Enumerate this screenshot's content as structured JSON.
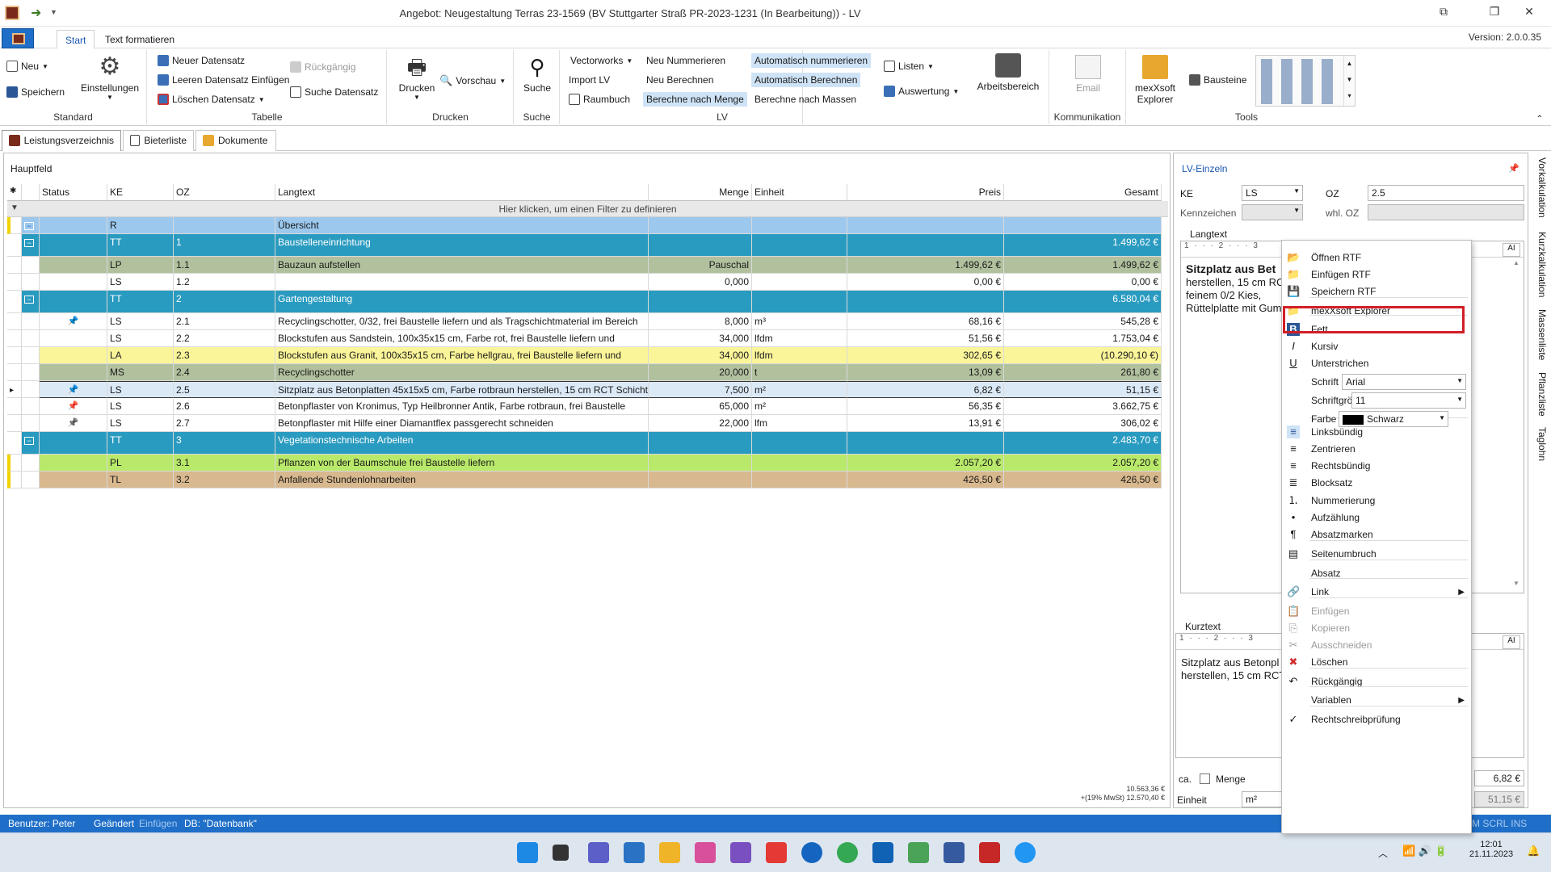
{
  "window": {
    "title": "Angebot: Neugestaltung Terras 23-1569 (BV Stuttgarter Straß PR-2023-1231 (In Bearbeitung)) - LV",
    "version": "Version: 2.0.0.35",
    "tabs": [
      "Start",
      "Text formatieren"
    ]
  },
  "ribbon": {
    "standard": {
      "label": "Standard",
      "neu": "Neu",
      "speichern": "Speichern",
      "einstellungen": "Einstellungen"
    },
    "tabelle": {
      "label": "Tabelle",
      "neuer_datensatz": "Neuer Datensatz",
      "leeren": "Leeren Datensatz Einfügen",
      "loeschen": "Löschen Datensatz",
      "rueckgaengig": "Rückgängig",
      "suche_datensatz": "Suche Datensatz"
    },
    "drucken": {
      "label": "Drucken",
      "drucken": "Drucken",
      "vorschau": "Vorschau"
    },
    "suche": {
      "label": "Suche",
      "suche": "Suche"
    },
    "lv": {
      "label": "LV",
      "vectorworks": "Vectorworks",
      "import_lv": "Import LV",
      "raumbuch": "Raumbuch",
      "neu_nummerieren": "Neu Nummerieren",
      "neu_berechnen": "Neu Berechnen",
      "berechne_menge": "Berechne nach Menge",
      "auto_nummerieren": "Automatisch nummerieren",
      "auto_berechnen": "Automatisch Berechnen",
      "berechne_massen": "Berechne nach Massen"
    },
    "listen": "Listen",
    "auswertung": "Auswertung",
    "arbeitsbereich": "Arbeitsbereich",
    "kommunikation": {
      "label": "Kommunikation",
      "email": "Email"
    },
    "tools": {
      "label": "Tools",
      "explorer": "mexXsoft Explorer",
      "bausteine": "Bausteine"
    }
  },
  "viewtabs": [
    "Leistungsverzeichnis",
    "Bieterliste",
    "Dokumente"
  ],
  "main": {
    "title": "Hauptfeld",
    "columns": [
      "Status",
      "KE",
      "OZ",
      "Langtext",
      "Menge",
      "Einheit",
      "Preis",
      "Gesamt"
    ],
    "filter_hint": "Hier klicken, um einen Filter zu definieren",
    "rows": [
      {
        "ke": "R",
        "oz": "",
        "langtext": "Übersicht",
        "menge": "",
        "einheit": "",
        "preis": "",
        "gesamt": ""
      },
      {
        "ke": "TT",
        "oz": "1",
        "langtext": "Baustelleneinrichtung",
        "menge": "",
        "einheit": "",
        "preis": "",
        "gesamt": "1.499,62 €"
      },
      {
        "ke": "LP",
        "oz": "1.1",
        "langtext": "Bauzaun aufstellen",
        "menge": "Pauschal",
        "einheit": "",
        "preis": "1.499,62 €",
        "gesamt": "1.499,62 €"
      },
      {
        "ke": "LS",
        "oz": "1.2",
        "langtext": "",
        "menge": "0,000",
        "einheit": "",
        "preis": "0,00 €",
        "gesamt": "0,00 €"
      },
      {
        "ke": "TT",
        "oz": "2",
        "langtext": "Gartengestaltung",
        "menge": "",
        "einheit": "",
        "preis": "",
        "gesamt": "6.580,04 €"
      },
      {
        "ke": "LS",
        "oz": "2.1",
        "langtext": "Recyclingschotter, 0/32, frei Baustelle liefern und als Tragschichtmaterial im Bereich",
        "menge": "8,000",
        "einheit": "m³",
        "preis": "68,16 €",
        "gesamt": "545,28 €"
      },
      {
        "ke": "LS",
        "oz": "2.2",
        "langtext": "Blockstufen aus Sandstein, 100x35x15 cm, Farbe rot, frei Baustelle liefern und",
        "menge": "34,000",
        "einheit": "lfdm",
        "preis": "51,56 €",
        "gesamt": "1.753,04 €"
      },
      {
        "ke": "LA",
        "oz": "2.3",
        "langtext": "Blockstufen aus Granit, 100x35x15 cm, Farbe hellgrau, frei Baustelle liefern und",
        "menge": "34,000",
        "einheit": "lfdm",
        "preis": "302,65 €",
        "gesamt": "(10.290,10 €)"
      },
      {
        "ke": "MS",
        "oz": "2.4",
        "langtext": "Recyclingschotter",
        "menge": "20,000",
        "einheit": "t",
        "preis": "13,09 €",
        "gesamt": "261,80 €"
      },
      {
        "ke": "LS",
        "oz": "2.5",
        "langtext": "Sitzplatz aus Betonplatten 45x15x5 cm, Farbe rotbraun herstellen, 15 cm RCT Schicht",
        "menge": "7,500",
        "einheit": "m²",
        "preis": "6,82 €",
        "gesamt": "51,15 €"
      },
      {
        "ke": "LS",
        "oz": "2.6",
        "langtext": "Betonpflaster von Kronimus, Typ Heilbronner Antik, Farbe rotbraun, frei Baustelle",
        "menge": "65,000",
        "einheit": "m²",
        "preis": "56,35 €",
        "gesamt": "3.662,75 €"
      },
      {
        "ke": "LS",
        "oz": "2.7",
        "langtext": "Betonpflaster mit Hilfe einer Diamantflex passgerecht schneiden",
        "menge": "22,000",
        "einheit": "lfm",
        "preis": "13,91 €",
        "gesamt": "306,02 €"
      },
      {
        "ke": "TT",
        "oz": "3",
        "langtext": "Vegetationstechnische Arbeiten",
        "menge": "",
        "einheit": "",
        "preis": "",
        "gesamt": "2.483,70 €"
      },
      {
        "ke": "PL",
        "oz": "3.1",
        "langtext": "Pflanzen von der Baumschule frei Baustelle liefern",
        "menge": "",
        "einheit": "",
        "preis": "2.057,20 €",
        "gesamt": "2.057,20 €"
      },
      {
        "ke": "TL",
        "oz": "3.2",
        "langtext": "Anfallende Stundenlohnarbeiten",
        "menge": "",
        "einheit": "",
        "preis": "426,50 €",
        "gesamt": "426,50 €"
      }
    ],
    "footer_total": "10.563,36 €",
    "footer_vat": "+(19% MwSt) 12.570,40 €"
  },
  "right": {
    "title": "LV-Einzeln",
    "ke_label": "KE",
    "ke_value": "LS",
    "oz_label": "OZ",
    "oz_value": "2.5",
    "kennzeichen_label": "Kennzeichen",
    "whl_oz_label": "whl. OZ",
    "langtext_label": "Langtext",
    "langtext_bold": "Sitzplatz aus Bet",
    "langtext_lines": [
      "herstellen, 15 cm RC",
      "feinem 0/2 Kies,",
      "Rüttelplatte mit Gum"
    ],
    "kurztext_label": "Kurztext",
    "kurztext_lines": [
      "Sitzplatz aus Betonpl",
      "herstellen, 15 cm RCT"
    ],
    "ca_label": "ca.",
    "menge_label": "Menge",
    "einheit_label": "Einheit",
    "einheit_value": "m²",
    "preis_value": "6,82 €",
    "gesamt_value": "51,15 €",
    "ruler": "1 · · · 2 · · · 3",
    "ai": "AI"
  },
  "sidetabs": [
    "Vorkalkulation",
    "Kurzkalkulation",
    "Massenliste",
    "Pflanzliste",
    "Taglohn"
  ],
  "context_menu": {
    "items": [
      {
        "label": "Öffnen RTF",
        "icon": "folder-open-icon"
      },
      {
        "label": "Einfügen RTF",
        "icon": "folder-icon"
      },
      {
        "label": "Speichern RTF",
        "icon": "save-icon"
      },
      {
        "label": "mexXsoft Explorer",
        "icon": "folder-icon"
      },
      {
        "label": "Fett",
        "icon": "bold-icon"
      },
      {
        "label": "Kursiv",
        "icon": "italic-icon"
      },
      {
        "label": "Unterstrichen",
        "icon": "underline-icon"
      },
      {
        "label": "Linksbündig",
        "icon": "align-left-icon"
      },
      {
        "label": "Zentrieren",
        "icon": "align-center-icon"
      },
      {
        "label": "Rechtsbündig",
        "icon": "align-right-icon"
      },
      {
        "label": "Blocksatz",
        "icon": "justify-icon"
      },
      {
        "label": "Nummerierung",
        "icon": "numbered-list-icon"
      },
      {
        "label": "Aufzählung",
        "icon": "bullet-list-icon"
      },
      {
        "label": "Absatzmarken",
        "icon": "pilcrow-icon"
      },
      {
        "label": "Seitenumbruch",
        "icon": "page-break-icon"
      },
      {
        "label": "Absatz",
        "icon": ""
      },
      {
        "label": "Link",
        "icon": "link-icon"
      },
      {
        "label": "Einfügen",
        "icon": "paste-icon"
      },
      {
        "label": "Kopieren",
        "icon": "copy-icon"
      },
      {
        "label": "Ausschneiden",
        "icon": "cut-icon"
      },
      {
        "label": "Löschen",
        "icon": "delete-icon"
      },
      {
        "label": "Rückgängig",
        "icon": "undo-icon"
      },
      {
        "label": "Variablen",
        "icon": ""
      },
      {
        "label": "Rechtschreibprüfung",
        "icon": "spellcheck-icon"
      }
    ],
    "schrift_label": "Schrift",
    "schrift_value": "Arial",
    "groesse_label": "Schriftgröße",
    "groesse_value": "11",
    "farbe_label": "Farbe",
    "farbe_value": "Schwarz"
  },
  "status": {
    "benutzer": "Benutzer: Peter",
    "geaendert": "Geändert",
    "einfuegen": "Einfügen",
    "db": "DB: \"Datenbank\"",
    "right": "M  SCRL  INS"
  },
  "taskbar": {
    "time": "12:01",
    "date": "21.11.2023"
  },
  "colors": {
    "accent": "#1f6fc8",
    "tt_row": "#2a9bc0",
    "r_row": "#9cc8ee",
    "lp_ms_row": "#b1c19e",
    "la_row": "#fbf59a",
    "pl_row": "#b9e96a",
    "tl_row": "#d8b88e",
    "highlight": "#d11f27"
  }
}
